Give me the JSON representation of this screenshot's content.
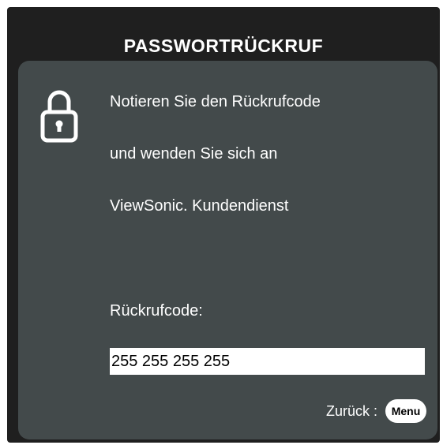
{
  "dialog": {
    "title": "PASSWORTRÜCKRUF",
    "icon": "lock-icon",
    "message_lines": [
      "Notieren Sie den Rückrufcode",
      "und wenden Sie sich an",
      "ViewSonic. Kundendienst"
    ],
    "code_label": "Rückrufcode:",
    "code_value": "255 255 255 255",
    "back_label": "Zurück :",
    "menu_button_label": "Menu"
  },
  "colors": {
    "frame": "#1f1f1f",
    "panel": "#434a4b",
    "text": "#ffffff",
    "field_background": "#ffffff"
  }
}
